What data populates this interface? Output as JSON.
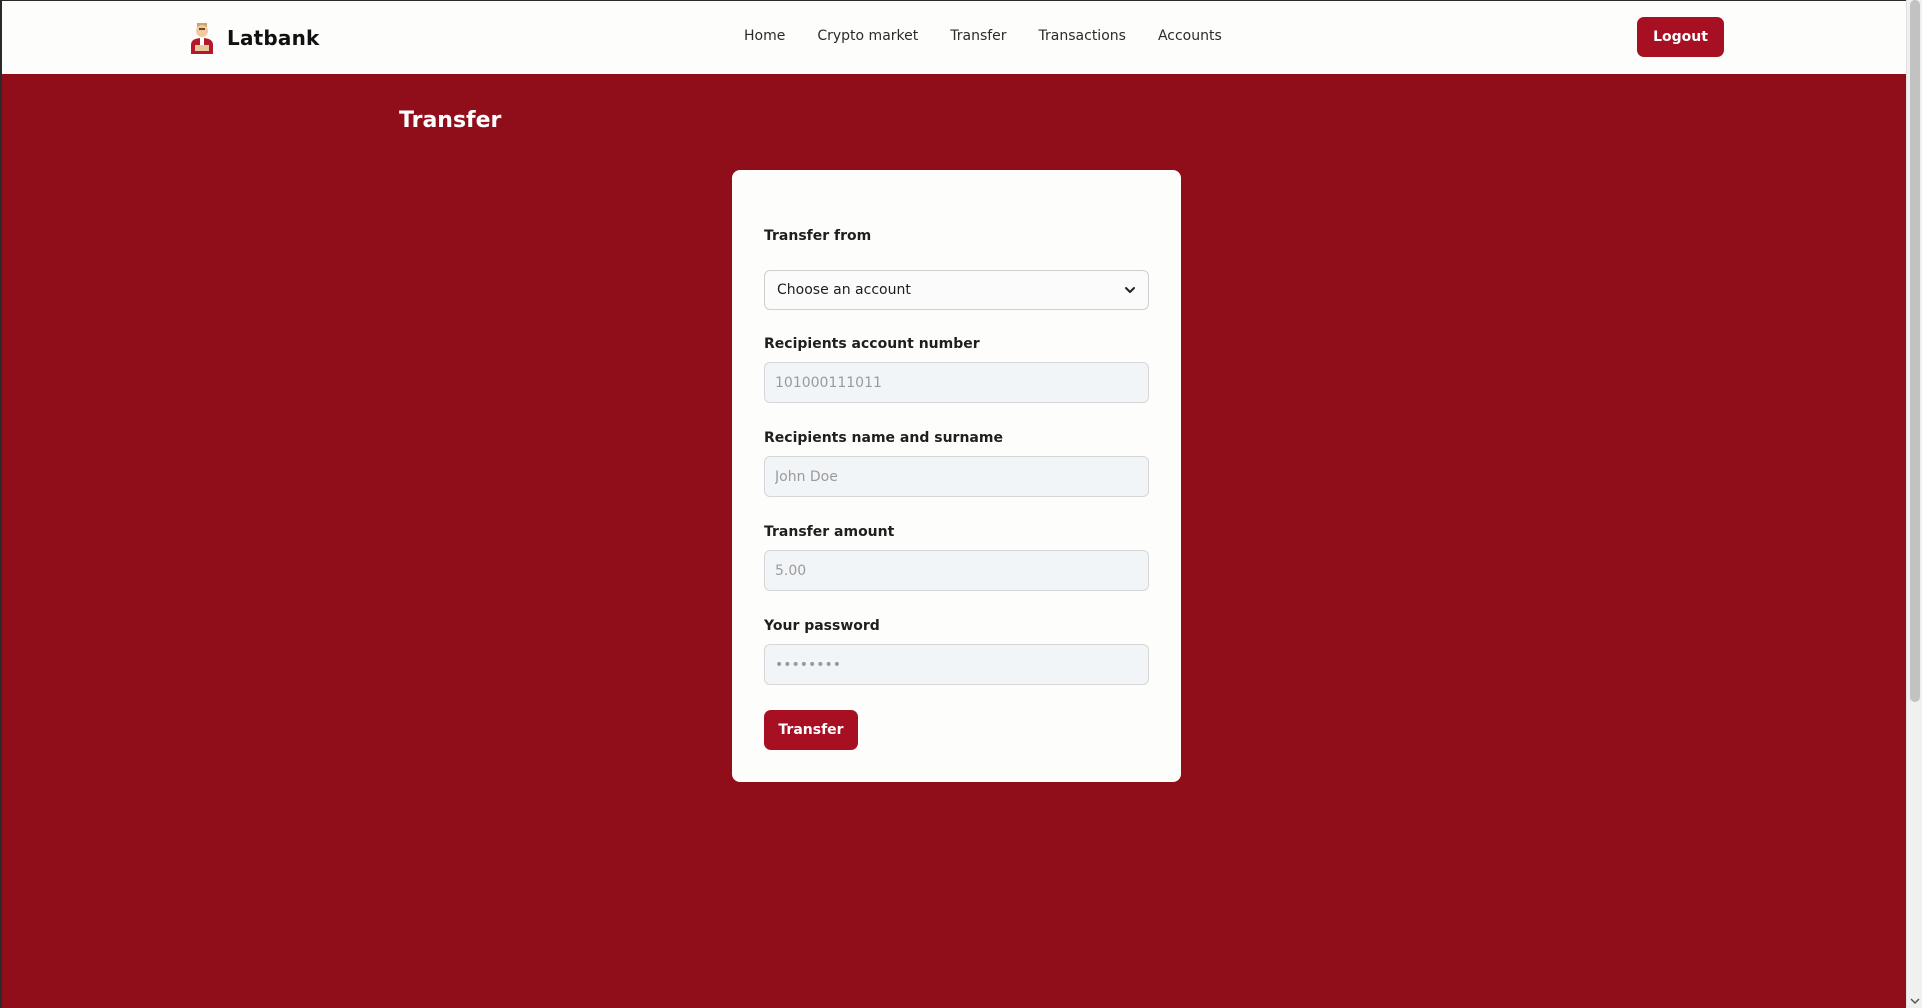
{
  "brand": {
    "name": "Latbank",
    "logo": "bank-clerk-logo"
  },
  "nav": {
    "links": [
      "Home",
      "Crypto market",
      "Transfer",
      "Transactions",
      "Accounts"
    ],
    "logout_label": "Logout"
  },
  "page": {
    "title": "Transfer"
  },
  "form": {
    "from": {
      "label": "Transfer from",
      "selected": "Choose an account"
    },
    "account_number": {
      "label": "Recipients account number",
      "placeholder": "101000111011"
    },
    "name": {
      "label": "Recipients name and surname",
      "placeholder": "John Doe"
    },
    "amount": {
      "label": "Transfer amount",
      "placeholder": "5.00"
    },
    "password": {
      "label": "Your password",
      "placeholder": "••••••••"
    },
    "submit_label": "Transfer"
  },
  "colors": {
    "background": "#8f0e1a",
    "accent": "#a70f22",
    "card": "#fdfdfc"
  }
}
